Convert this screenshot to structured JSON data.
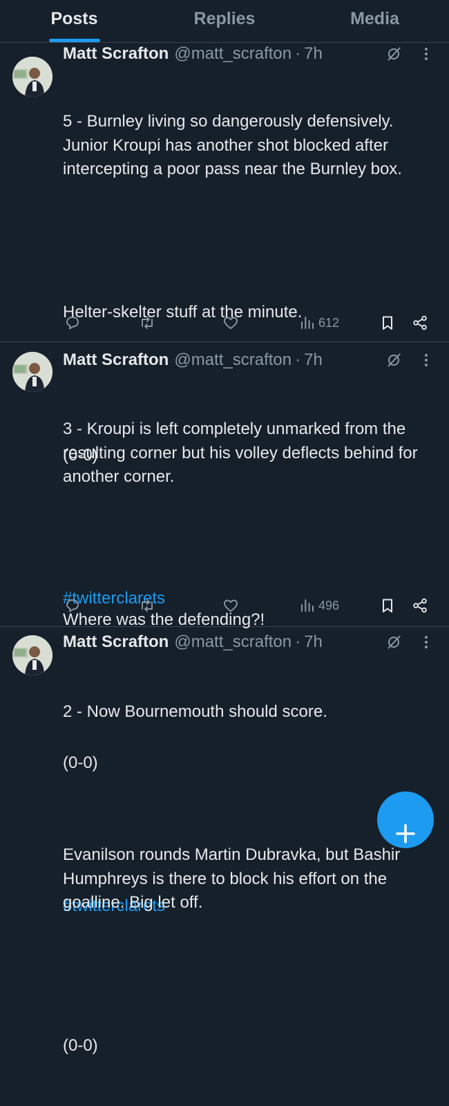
{
  "tabs": [
    "Posts",
    "Replies",
    "Media"
  ],
  "posts": [
    {
      "name": "Matt Scrafton",
      "handle": "@matt_scrafton",
      "dot": "·",
      "time": "7h",
      "paragraphs": [
        "5 - Burnley living so dangerously defensively. Junior Kroupi has another shot blocked after intercepting a poor pass near the Burnley box.",
        "Helter-skelter stuff at the minute.",
        "(0-0)"
      ],
      "hashtag": "#twitterclarets",
      "views": "612"
    },
    {
      "name": "Matt Scrafton",
      "handle": "@matt_scrafton",
      "dot": "·",
      "time": "7h",
      "paragraphs": [
        "3 - Kroupi is left completely unmarked from the resulting corner but his volley deflects behind for another corner.",
        "Where was the defending?!",
        "(0-0)"
      ],
      "hashtag": "#twitterclarets",
      "views": "496"
    },
    {
      "name": "Matt Scrafton",
      "handle": "@matt_scrafton",
      "dot": "·",
      "time": "7h",
      "paragraphs": [
        "2 - Now Bournemouth should score.",
        "Evanilson rounds Martin Dubravka, but Bashir Humphreys is there to block his effort on the goalline. Big let off.",
        "(0-0)"
      ]
    }
  ],
  "icons": {
    "reply": "reply-icon",
    "repost": "repost-icon",
    "like": "like-icon",
    "views": "views-icon",
    "bookmark": "bookmark-icon",
    "share": "share-icon",
    "grok": "grok-icon",
    "more": "more-icon",
    "compose": "plus-icon"
  },
  "colors": {
    "background": "#15202b",
    "accent": "#1d9bf0",
    "muted": "#8b98a5",
    "divider": "#38444d"
  }
}
